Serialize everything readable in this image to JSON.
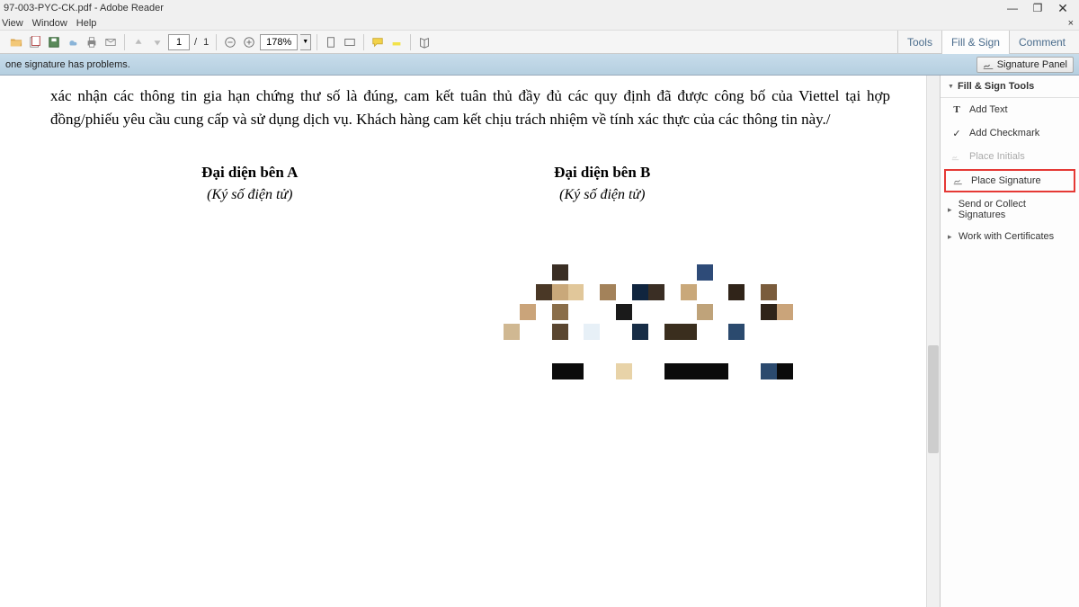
{
  "window": {
    "title": "97-003-PYC-CK.pdf - Adobe Reader",
    "btn_min": "—",
    "btn_max": "❐",
    "btn_close": "✕"
  },
  "menu": {
    "view": "View",
    "window": "Window",
    "help": "Help",
    "close_x": "×"
  },
  "toolbar": {
    "page_current": "1",
    "page_sep": "/",
    "page_total": "1",
    "zoom": "178%",
    "tabs": {
      "tools": "Tools",
      "fill_sign": "Fill & Sign",
      "comment": "Comment"
    }
  },
  "message_bar": {
    "text": "one signature has problems.",
    "sig_panel": "Signature Panel"
  },
  "document": {
    "paragraph": "xác nhận các thông tin gia hạn chứng thư số là đúng, cam kết tuân thủ đầy đủ các quy định đã được công bố của Viettel tại hợp đồng/phiếu yêu cầu cung cấp và sử dụng dịch vụ. Khách hàng cam kết chịu trách nhiệm về tính xác thực của các thông tin này./",
    "rep_a_title": "Đại diện bên A",
    "rep_a_sub": "(Ký số điện tử)",
    "rep_b_title": "Đại diện bên B",
    "rep_b_sub": "(Ký số điện tử)"
  },
  "right_panel": {
    "header": "Fill & Sign Tools",
    "add_text": "Add Text",
    "add_checkmark": "Add Checkmark",
    "place_initials": "Place Initials",
    "place_signature": "Place Signature",
    "send_collect": "Send or Collect Signatures",
    "work_certs": "Work with Certificates"
  },
  "pixel_rows": [
    [
      "",
      "",
      "",
      "#3a2e24",
      "",
      "",
      "",
      "",
      "",
      "",
      "",
      "",
      "#2e4b78",
      "",
      "",
      "",
      "",
      "",
      ""
    ],
    [
      "",
      "",
      "#4a3826",
      "#c9a87a",
      "#e1c79a",
      "",
      "#a3825a",
      "",
      "#10253f",
      "#3a2e24",
      "",
      "#c9a87a",
      "",
      "",
      "#302419",
      "",
      "#7a5c3c",
      "",
      ""
    ],
    [
      "",
      "#caa47a",
      "",
      "#8a6e4a",
      "",
      "",
      "",
      "#1a1a1a",
      "",
      "",
      "",
      "",
      "#bfa37a",
      "",
      "",
      "",
      "#302419",
      "#caa47a",
      ""
    ],
    [
      "#d0b892",
      "",
      "",
      "#5a4630",
      "",
      "#e7f0f7",
      "",
      "",
      "#172d46",
      "",
      "#3a2e1e",
      "#3a2e1e",
      "",
      "",
      "#2b4a6e",
      "",
      "",
      "",
      ""
    ],
    [
      "",
      "",
      "",
      "",
      "",
      "",
      "",
      "",
      "",
      "",
      "",
      "",
      "",
      "",
      "",
      "",
      "",
      "",
      ""
    ],
    [
      "",
      "",
      "",
      "#0b0b0b",
      "#0b0b0b",
      "",
      "",
      "#e8d3a8",
      "",
      "",
      "#0b0b0b",
      "#0b0b0b",
      "#0b0b0b",
      "#0b0b0b",
      "",
      "",
      "#2b4a6e",
      "#0b0b0b",
      ""
    ]
  ]
}
